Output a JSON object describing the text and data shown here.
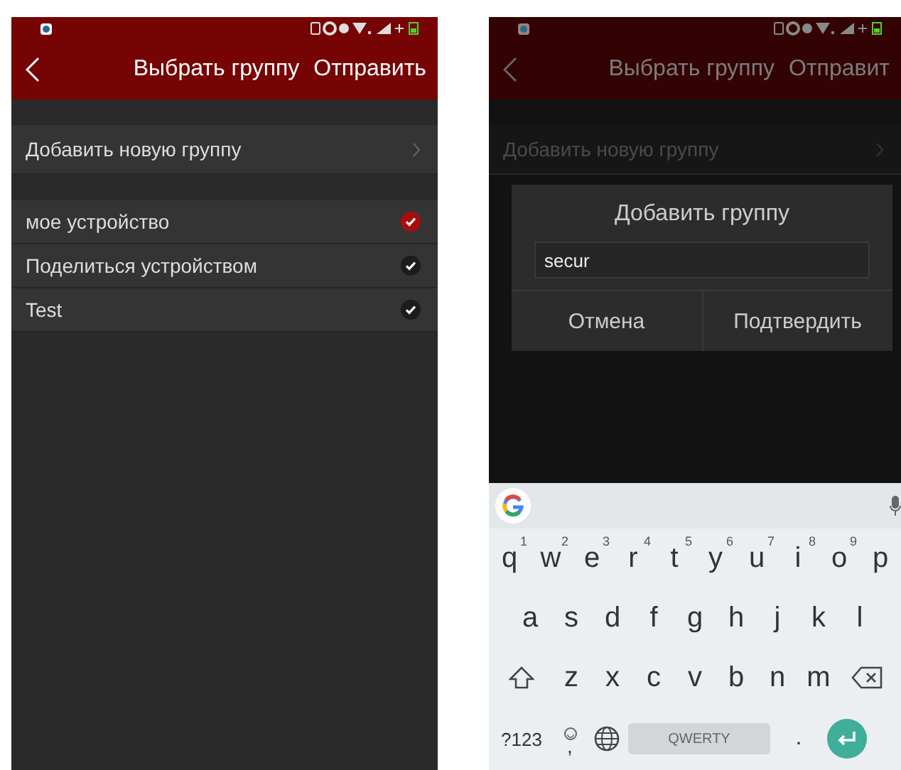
{
  "screens": [
    {
      "kind": "list",
      "header": {
        "title": "Выбрать группу",
        "action": "Отправить"
      },
      "add_row": {
        "label": "Добавить новую группу"
      },
      "groups": [
        {
          "name": "мое устройство",
          "selected": true
        },
        {
          "name": "Поделиться устройством",
          "selected": false
        },
        {
          "name": "Test",
          "selected": false
        }
      ]
    },
    {
      "kind": "dialog",
      "header": {
        "title": "Выбрать группу",
        "action": "Отправит"
      },
      "add_row": {
        "label": "Добавить новую группу"
      },
      "dialog": {
        "title": "Добавить группу",
        "input_value": "secur",
        "buttons": [
          "Отмена",
          "Подтвердить"
        ]
      },
      "keyboard": {
        "rows": [
          [
            {
              "key": "q",
              "hint": "1"
            },
            {
              "key": "w",
              "hint": "2"
            },
            {
              "key": "e",
              "hint": "3"
            },
            {
              "key": "r",
              "hint": "4"
            },
            {
              "key": "t",
              "hint": "5"
            },
            {
              "key": "y",
              "hint": "6"
            },
            {
              "key": "u",
              "hint": "7"
            },
            {
              "key": "i",
              "hint": "8"
            },
            {
              "key": "o",
              "hint": "9"
            },
            {
              "key": "p"
            }
          ],
          [
            {
              "key": "a"
            },
            {
              "key": "s"
            },
            {
              "key": "d"
            },
            {
              "key": "f"
            },
            {
              "key": "g"
            },
            {
              "key": "h"
            },
            {
              "key": "j"
            },
            {
              "key": "k"
            },
            {
              "key": "l"
            }
          ],
          [
            {
              "key": "z"
            },
            {
              "key": "x"
            },
            {
              "key": "c"
            },
            {
              "key": "v"
            },
            {
              "key": "b"
            },
            {
              "key": "n"
            },
            {
              "key": "m"
            }
          ]
        ],
        "symbols": "?123",
        "comma": ",",
        "space": "QWERTY",
        "period": "."
      }
    }
  ]
}
